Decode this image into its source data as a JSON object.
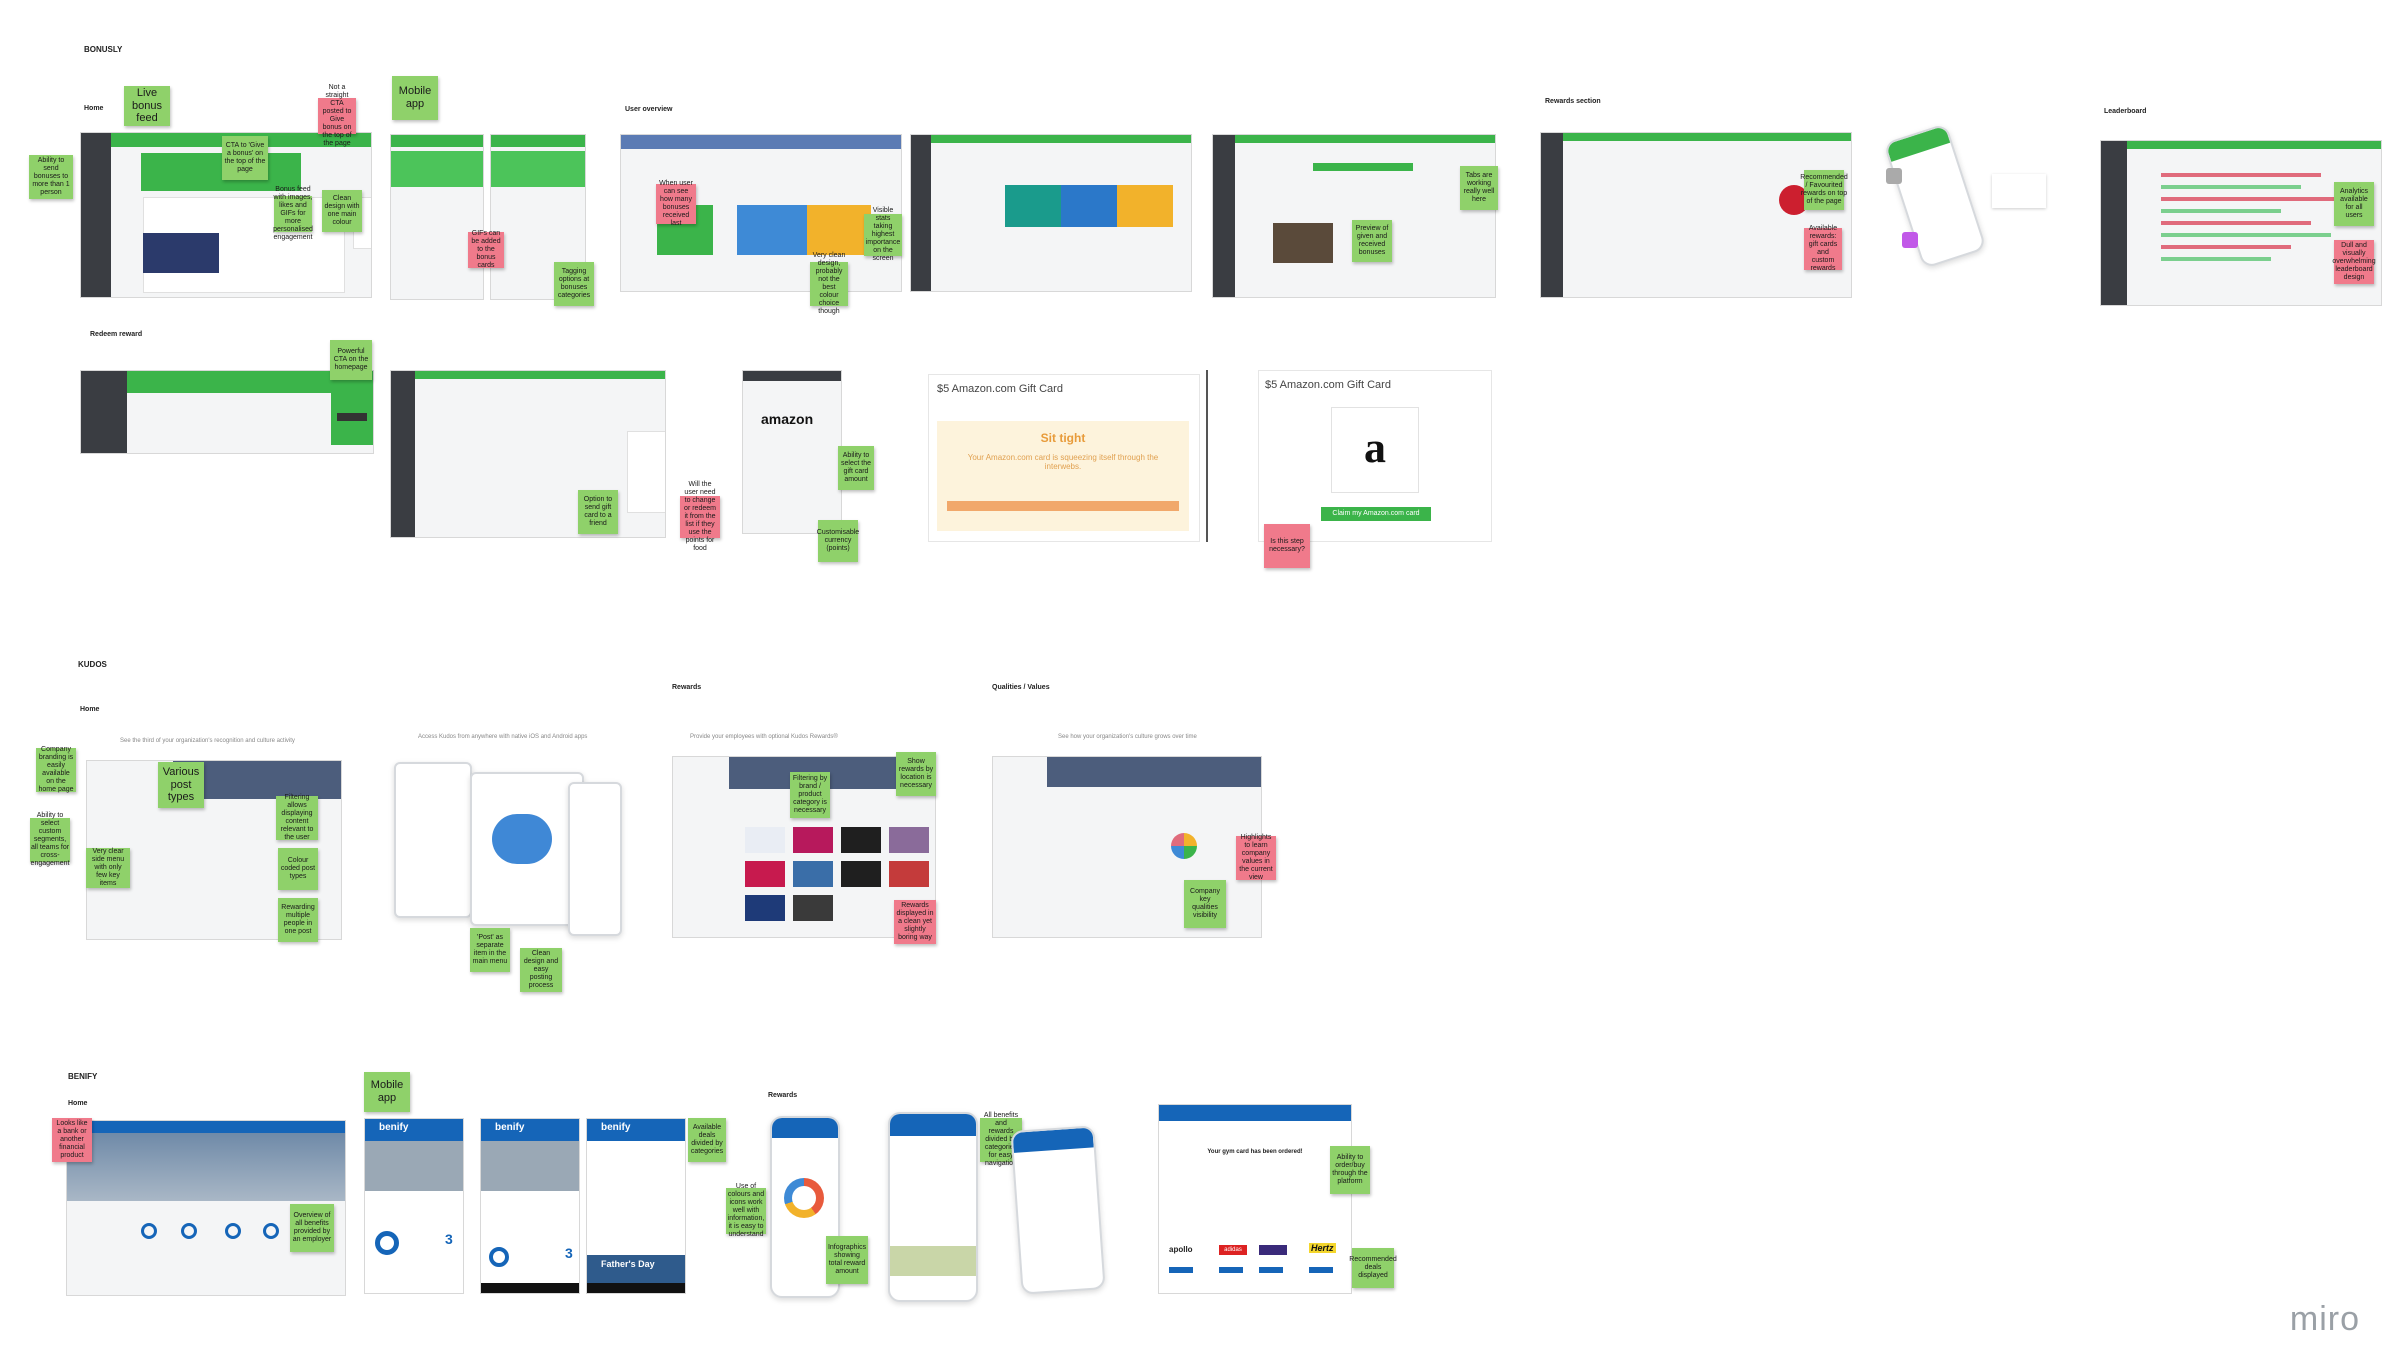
{
  "board": {
    "logo_text": "miro"
  },
  "sections": {
    "bonusly": {
      "title": "BONUSLY",
      "labels": {
        "home": "Home",
        "user_overview": "User overview",
        "rewards_section": "Rewards section",
        "leaderboard": "Leaderboard",
        "redeem_reward": "Redeem reward"
      },
      "notes": {
        "live_bonus_feed": "Live bonus feed",
        "cta_give_bonus": "CTA to 'Give a bonus' on the top of the page",
        "ability_to_send": "Ability to send bonuses to more than 1 person",
        "not_a_straight_cta": "Not a straight CTA posted to Give bonus on the top of the page",
        "bonus_feed_images": "Bonus feed with images, likes and GIFs for more personalised engagement",
        "clean_design": "Clean design with one main colour",
        "mobile_app": "Mobile app",
        "gifs_added": "GIFs can be added to the bonus cards",
        "tagging_options": "Tagging options at bonuses categories",
        "see_own_bonus": "When user can see how many bonuses received last",
        "visible_stats": "Visible stats taking highest importance on the screen",
        "very_clean_design": "Very clean design, probably not the best colour choice though",
        "tabs_working": "Tabs are working really well here",
        "preview_bonuses": "Preview of given and received bonuses",
        "recommended_rewards": "Recommended / Favourited rewards on top of the page",
        "available_rewards": "Available rewards: gift cards and custom rewards",
        "analytics": "Analytics available for all users",
        "dull_analytics": "Dull and visually overwhelming leaderboard design",
        "powerful_cta": "Powerful CTA on the homepage",
        "option_send_gift": "Option to send gift card to a friend",
        "bonusly_fields": "Will the user need to change or redeem it from the list if they use the points for food",
        "ability_select": "Ability to select the gift card amount",
        "customisable_currency": "Customisable currency (points)",
        "is_this_step": "Is this step necessary?"
      },
      "gift_card": {
        "title_left": "$5 Amazon.com Gift Card",
        "sit_tight": "Sit tight",
        "sit_tight_desc": "Your Amazon.com card is squeezing itself through the interwebs.",
        "title_right": "$5 Amazon.com Gift Card",
        "claim_button": "Claim my Amazon.com card",
        "amazon_word": "amazon"
      }
    },
    "kudos": {
      "title": "KUDOS",
      "labels": {
        "home": "Home",
        "rewards": "Rewards",
        "qualities": "Qualities / Values"
      },
      "captions": {
        "home": "See the third of your organization's recognition and culture activity",
        "mobile": "Access Kudos from anywhere with native iOS and Android apps",
        "rewards": "Provide your employees with optional Kudos Rewards®",
        "qualities": "See how your organization's culture grows over time"
      },
      "notes": {
        "company_branding": "Company branding is easily available on the home page",
        "various_post_types": "Various post types",
        "ability_filter": "Ability to select custom segments, all teams for cross-engagement",
        "filtering": "Filtering allows displaying content relevant to the user",
        "very_clear_side": "Very clear side menu with only few key items",
        "colour_coded": "Colour coded post types",
        "rewarding_multiple": "Rewarding multiple people in one post",
        "post_separate": "'Post' as separate item in the main menu",
        "clean_posting": "Clean design and easy posting process",
        "show_rewards": "Show rewards by location is necessary",
        "filtering_brand": "Filtering by brand / product category is necessary",
        "rewards_displayed": "Rewards displayed in a clean yet slightly boring way",
        "highlight_values": "Highlights to learn company values in the current view",
        "company_qualities": "Company key qualities visibility"
      }
    },
    "benify": {
      "title": "BENIFY",
      "labels": {
        "home": "Home",
        "rewards": "Rewards"
      },
      "notes": {
        "looks_like_bank": "Looks like a bank or another financial product",
        "overview_benefits": "Overview of all benefits provided by an employer",
        "mobile_app": "Mobile app",
        "available_deals": "Available deals divided by categories",
        "use_of_colours": "Use of colours and icons work well with information, it is easy to understand",
        "infographics": "Infographics showing total reward amount",
        "all_benefits": "All benefits and rewards divided by categories for easy navigation",
        "ability_order": "Ability to order/buy through the platform",
        "recommended_deals": "Recommended deals displayed"
      },
      "ui": {
        "brand": "benify",
        "fathers_day": "Father's Day",
        "stat_1": "3",
        "stat_2": "3",
        "confirm_title": "Your gym card has been ordered!",
        "brands": [
          "apollo",
          "adidas",
          "",
          "Hertz"
        ]
      }
    }
  },
  "colors": {
    "bonusly_green": "#3bb44a",
    "benify_blue": "#1565b8",
    "sticky_green": "#8fd16a",
    "sticky_red": "#f07a8b",
    "sidebar_dark": "#3a3d42"
  }
}
